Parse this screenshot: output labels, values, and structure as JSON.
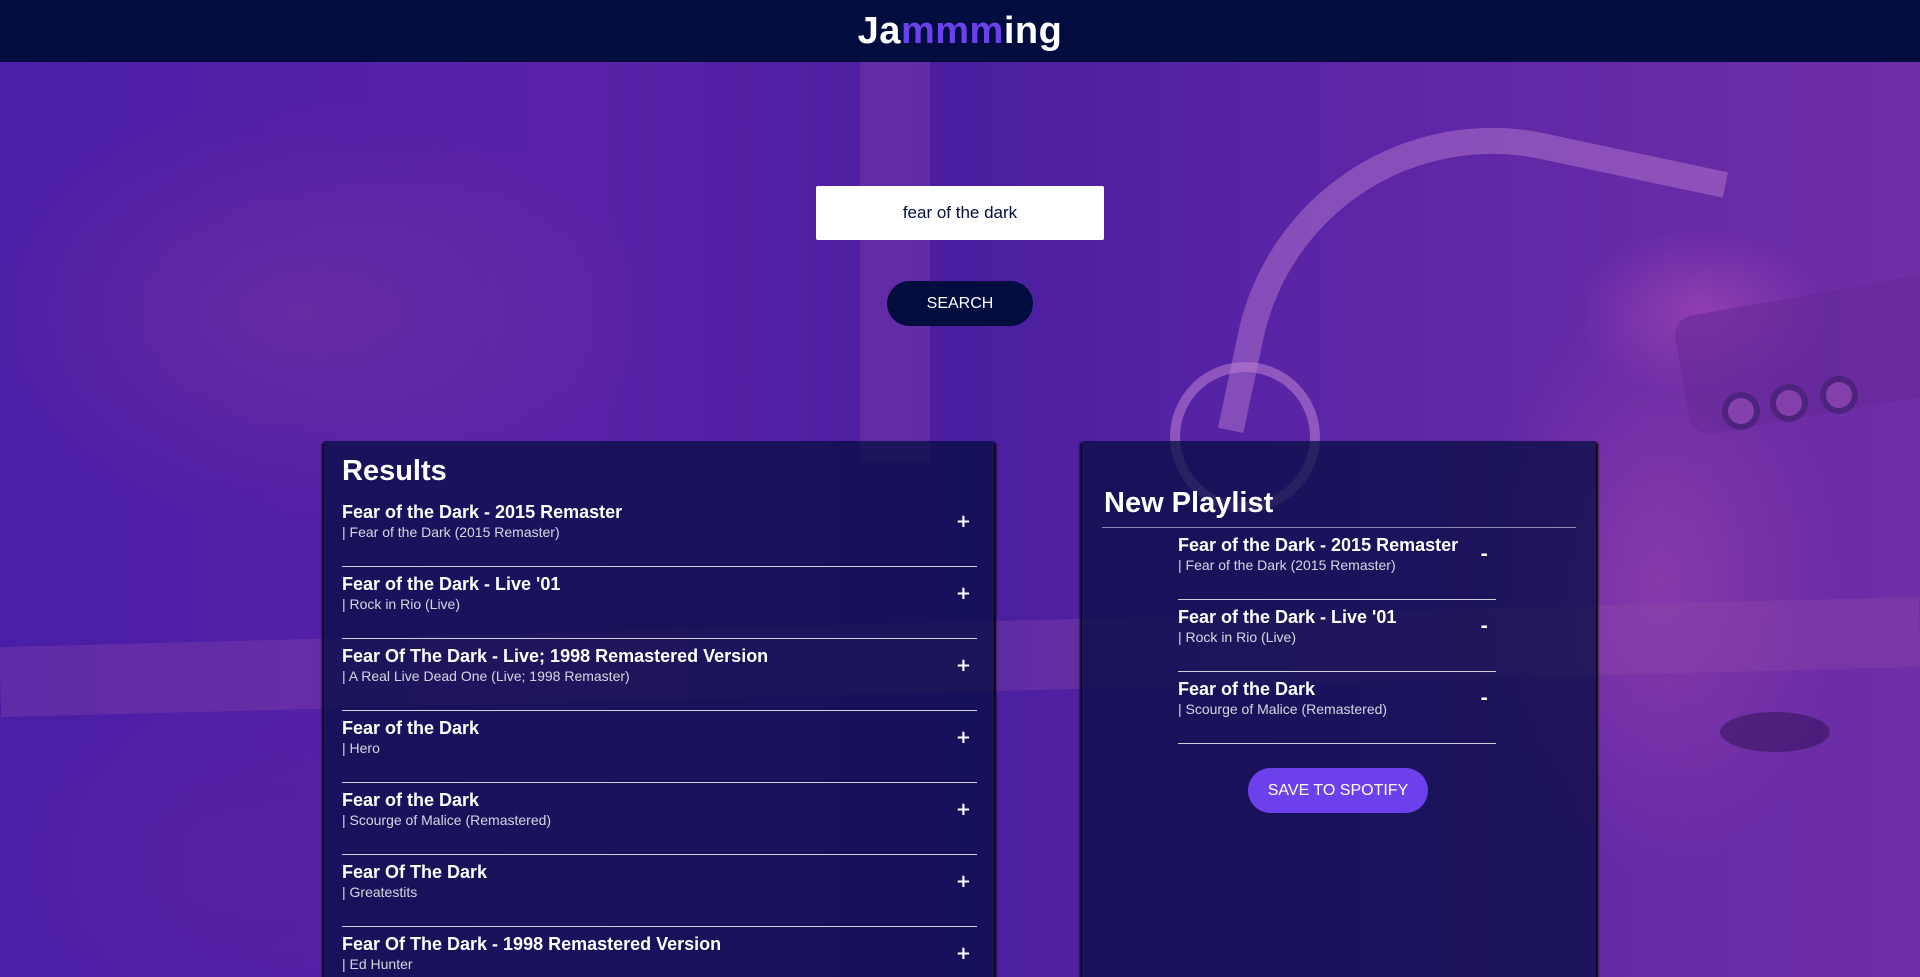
{
  "app": {
    "logo_prefix": "Ja",
    "logo_highlight": "mmm",
    "logo_suffix": "ing"
  },
  "search": {
    "value": "fear of the dark",
    "button_label": "SEARCH"
  },
  "results": {
    "title": "Results",
    "tracks": [
      {
        "name": "Fear of the Dark - 2015 Remaster",
        "info": "| Fear of the Dark (2015 Remaster)",
        "action": "+"
      },
      {
        "name": "Fear of the Dark - Live '01",
        "info": "| Rock in Rio (Live)",
        "action": "+"
      },
      {
        "name": "Fear Of The Dark - Live; 1998 Remastered Version",
        "info": "| A Real Live Dead One (Live; 1998 Remaster)",
        "action": "+"
      },
      {
        "name": "Fear of the Dark",
        "info": "| Hero",
        "action": "+"
      },
      {
        "name": "Fear of the Dark",
        "info": "| Scourge of Malice (Remastered)",
        "action": "+"
      },
      {
        "name": "Fear Of The Dark",
        "info": "| Greatestits",
        "action": "+"
      },
      {
        "name": "Fear Of The Dark - 1998 Remastered Version",
        "info": "| Ed Hunter",
        "action": "+"
      }
    ]
  },
  "playlist": {
    "name": "New Playlist",
    "tracks": [
      {
        "name": "Fear of the Dark - 2015 Remaster",
        "info": "| Fear of the Dark (2015 Remaster)",
        "action": "-"
      },
      {
        "name": "Fear of the Dark - Live '01",
        "info": "| Rock in Rio (Live)",
        "action": "-"
      },
      {
        "name": "Fear of the Dark",
        "info": "| Scourge of Malice (Remastered)",
        "action": "-"
      }
    ],
    "save_label": "SAVE TO SPOTIFY"
  },
  "colors": {
    "header_bg": "#010c3f",
    "accent": "#6c41ec",
    "panel_bg": "#010c3f"
  }
}
